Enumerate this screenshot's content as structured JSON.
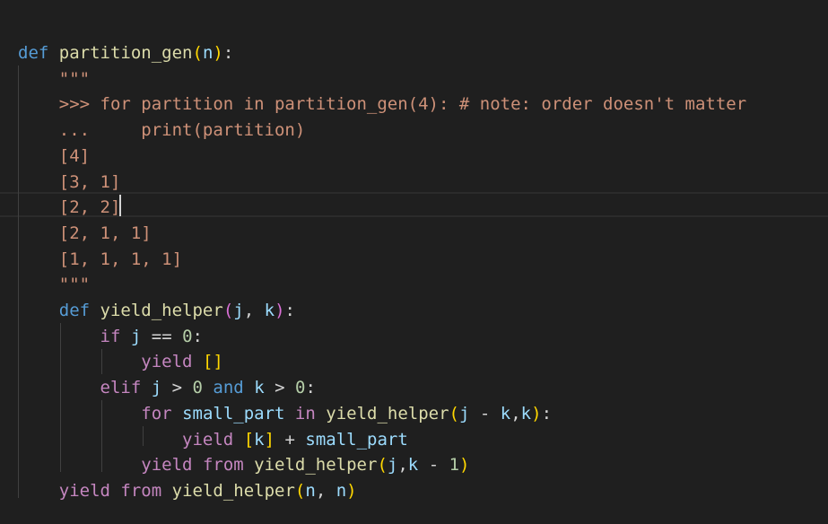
{
  "editor": {
    "language": "python",
    "colors": {
      "background": "#1f1f1f",
      "keyword": "#569cd6",
      "control": "#c586c0",
      "function": "#dcdcaa",
      "parameter": "#9cdcfe",
      "number": "#b5cea8",
      "string": "#ce9178",
      "bracket_level_1": "#ffd700",
      "bracket_level_2": "#da70d6"
    },
    "cursor": {
      "line": 7
    },
    "lines": [
      [
        [
          "def",
          "kw"
        ],
        [
          " ",
          "pun"
        ],
        [
          "partition_gen",
          "fn"
        ],
        [
          "(",
          "b1"
        ],
        [
          "n",
          "par"
        ],
        [
          ")",
          "b1"
        ],
        [
          ":",
          "pun"
        ]
      ],
      [
        [
          "    \"\"\"",
          "str"
        ]
      ],
      [
        [
          "    >>> for partition in partition_gen(4): # note: order doesn't matter",
          "str"
        ]
      ],
      [
        [
          "    ...     print(partition)",
          "str"
        ]
      ],
      [
        [
          "    [4]",
          "str"
        ]
      ],
      [
        [
          "    [3, 1]",
          "str"
        ]
      ],
      [
        [
          "    [2, 2]",
          "str"
        ]
      ],
      [
        [
          "    [2, 1, 1]",
          "str"
        ]
      ],
      [
        [
          "    [1, 1, 1, 1]",
          "str"
        ]
      ],
      [
        [
          "    \"\"\"",
          "str"
        ]
      ],
      [
        [
          "    ",
          "pun"
        ],
        [
          "def",
          "kw"
        ],
        [
          " ",
          "pun"
        ],
        [
          "yield_helper",
          "fn"
        ],
        [
          "(",
          "b2"
        ],
        [
          "j",
          "par"
        ],
        [
          ", ",
          "pun"
        ],
        [
          "k",
          "par"
        ],
        [
          ")",
          "b2"
        ],
        [
          ":",
          "pun"
        ]
      ],
      [
        [
          "        ",
          "pun"
        ],
        [
          "if",
          "ctl"
        ],
        [
          " ",
          "pun"
        ],
        [
          "j",
          "par"
        ],
        [
          " == ",
          "pun"
        ],
        [
          "0",
          "num"
        ],
        [
          ":",
          "pun"
        ]
      ],
      [
        [
          "            ",
          "pun"
        ],
        [
          "yield",
          "ctl"
        ],
        [
          " ",
          "pun"
        ],
        [
          "[]",
          "b1"
        ]
      ],
      [
        [
          "        ",
          "pun"
        ],
        [
          "elif",
          "ctl"
        ],
        [
          " ",
          "pun"
        ],
        [
          "j",
          "par"
        ],
        [
          " > ",
          "pun"
        ],
        [
          "0",
          "num"
        ],
        [
          " ",
          "pun"
        ],
        [
          "and",
          "kw"
        ],
        [
          " ",
          "pun"
        ],
        [
          "k",
          "par"
        ],
        [
          " > ",
          "pun"
        ],
        [
          "0",
          "num"
        ],
        [
          ":",
          "pun"
        ]
      ],
      [
        [
          "            ",
          "pun"
        ],
        [
          "for",
          "ctl"
        ],
        [
          " ",
          "pun"
        ],
        [
          "small_part",
          "par"
        ],
        [
          " ",
          "pun"
        ],
        [
          "in",
          "ctl"
        ],
        [
          " ",
          "pun"
        ],
        [
          "yield_helper",
          "fn"
        ],
        [
          "(",
          "b1"
        ],
        [
          "j",
          "par"
        ],
        [
          " - ",
          "pun"
        ],
        [
          "k",
          "par"
        ],
        [
          ",",
          "pun"
        ],
        [
          "k",
          "par"
        ],
        [
          ")",
          "b1"
        ],
        [
          ":",
          "pun"
        ]
      ],
      [
        [
          "                ",
          "pun"
        ],
        [
          "yield",
          "ctl"
        ],
        [
          " ",
          "pun"
        ],
        [
          "[",
          "b1"
        ],
        [
          "k",
          "par"
        ],
        [
          "]",
          "b1"
        ],
        [
          " + ",
          "pun"
        ],
        [
          "small_part",
          "par"
        ]
      ],
      [
        [
          "            ",
          "pun"
        ],
        [
          "yield",
          "ctl"
        ],
        [
          " ",
          "pun"
        ],
        [
          "from",
          "ctl"
        ],
        [
          " ",
          "pun"
        ],
        [
          "yield_helper",
          "fn"
        ],
        [
          "(",
          "b1"
        ],
        [
          "j",
          "par"
        ],
        [
          ",",
          "pun"
        ],
        [
          "k",
          "par"
        ],
        [
          " - ",
          "pun"
        ],
        [
          "1",
          "num"
        ],
        [
          ")",
          "b1"
        ]
      ],
      [
        [
          "    ",
          "pun"
        ],
        [
          "yield",
          "ctl"
        ],
        [
          " ",
          "pun"
        ],
        [
          "from",
          "ctl"
        ],
        [
          " ",
          "pun"
        ],
        [
          "yield_helper",
          "fn"
        ],
        [
          "(",
          "b1"
        ],
        [
          "n",
          "par"
        ],
        [
          ", ",
          "pun"
        ],
        [
          "n",
          "par"
        ],
        [
          ")",
          "b1"
        ]
      ]
    ]
  }
}
